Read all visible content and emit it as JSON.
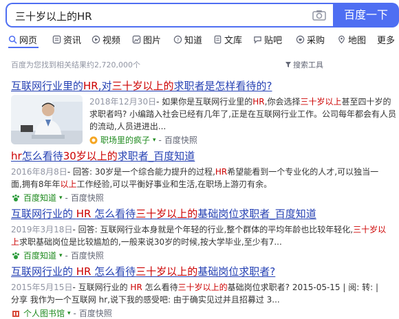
{
  "search": {
    "query": "三十岁以上的HR",
    "button": "百度一下"
  },
  "tabs": [
    {
      "label": "网页",
      "icon": "search-icon"
    },
    {
      "label": "资讯",
      "icon": "news-icon"
    },
    {
      "label": "视频",
      "icon": "video-icon"
    },
    {
      "label": "图片",
      "icon": "image-icon"
    },
    {
      "label": "知道",
      "icon": "question-icon"
    },
    {
      "label": "文库",
      "icon": "doc-icon"
    },
    {
      "label": "贴吧",
      "icon": "chat-icon"
    },
    {
      "label": "采购",
      "icon": "shopping-icon"
    },
    {
      "label": "地图",
      "icon": "map-icon"
    },
    {
      "label": "更多",
      "icon": ""
    }
  ],
  "meta": {
    "count_text": "百度为您找到相关结果约2,720,000个",
    "tools": "搜索工具"
  },
  "results": [
    {
      "title": [
        "互联网行业里的",
        "HR",
        ",对",
        "三十岁以上的",
        "求职者是怎样看待的?"
      ],
      "date": "2018年12月30日",
      "text_parts": [
        "- 如果你是互联网行业里的",
        "HR",
        ",你会选择",
        "三十岁以上",
        "甚至四十岁的求职者吗? 小编踏入社会已经有几年了,正是在互联网行业工作。公司每年都会有人员的流动,人员进进出..."
      ],
      "source": "职场里的疯子",
      "snapshot": "百度快照"
    },
    {
      "title": [
        "hr",
        "怎么看待",
        "30岁以上的",
        "求职者_百度知道"
      ],
      "date": "2016年8月8日",
      "text_parts": [
        "- 回答: 30岁是一个综合能力提升的过程,",
        "HR",
        "希望能看到一个专业化的人才,可以独当一面,拥有8年年",
        "以上",
        "工作经验,可以平衡好事业和生活,在职场上游刃有余。"
      ],
      "source": "百度知道",
      "snapshot": "百度快照"
    },
    {
      "title": [
        "互联网行业的 ",
        "HR",
        " 怎么看待",
        "三十岁以上的",
        "基础岗位求职者_百度知道"
      ],
      "date": "2019年3月18日",
      "text_parts": [
        "- 回答: 互联网行业本身就是个年轻的行业,整个群体的平均年龄也比较年轻化,",
        "三十岁以上",
        "求职基础岗位是比较尴尬的,一般来说30岁的时候,按大学毕业,至少有7..."
      ],
      "source": "百度知道",
      "snapshot": "百度快照"
    },
    {
      "title": [
        "互联网行业的 ",
        "HR",
        " 怎么看待",
        "三十岁以上的",
        "基础岗位求职者?"
      ],
      "date": "2015年5月15日",
      "text_parts": [
        "- 互联网行业的 ",
        "HR",
        " 怎么看待",
        "三十岁以上的",
        "基础岗位求职者? 2015-05-15 | 阅: 转: | 分享 我作为一个互联网 hr,说下我的感受吧: 由于确实见过并且招募过 3..."
      ],
      "source": "个人图书馆",
      "snapshot": "百度快照"
    }
  ],
  "colors": {
    "accent": "#4e6ef2",
    "link": "#2440b3",
    "highlight": "#cc0000",
    "source_green": "#1e8a1e"
  }
}
